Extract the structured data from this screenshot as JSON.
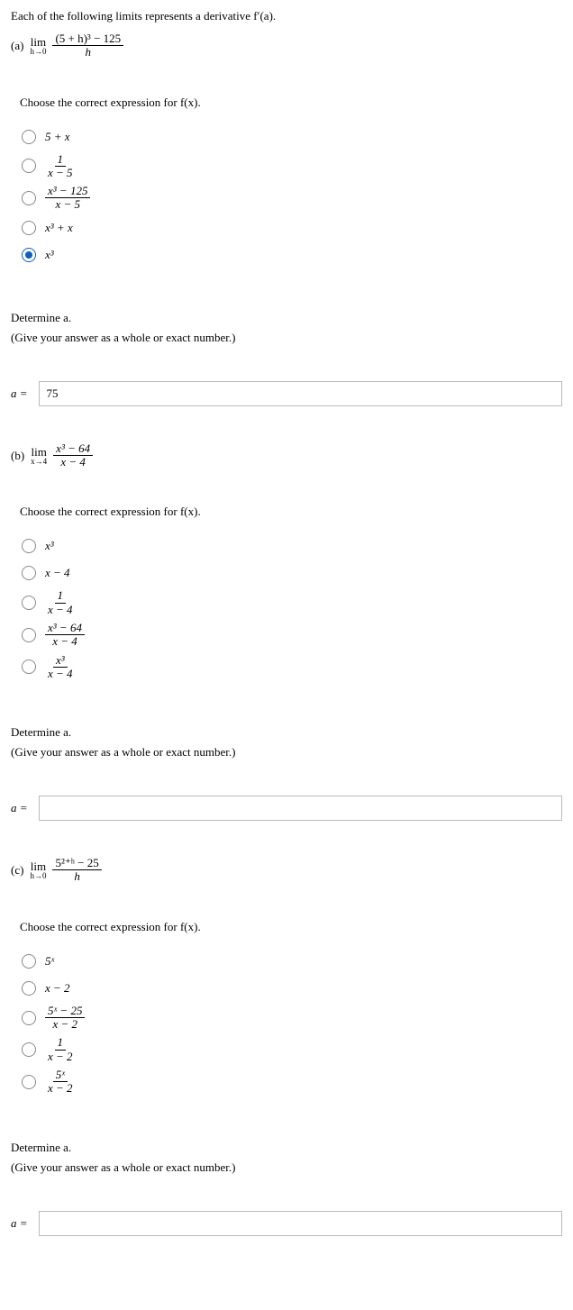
{
  "intro": "Each of the following limits represents a derivative f′(a).",
  "parts": {
    "a": {
      "label": "(a)",
      "limit_prefix": "lim",
      "limit_sub": "h→0",
      "limit_num": "(5 + h)³ − 125",
      "limit_den": "h",
      "choose_prompt": "Choose the correct expression for f(x).",
      "options": [
        {
          "text_plain": "5 + x",
          "frac": null,
          "selected": false
        },
        {
          "text_plain": null,
          "frac": {
            "num": "1",
            "den": "x − 5"
          },
          "selected": false
        },
        {
          "text_plain": null,
          "frac": {
            "num": "x³ − 125",
            "den": "x − 5"
          },
          "selected": false
        },
        {
          "text_plain": "x³ + x",
          "frac": null,
          "selected": false
        },
        {
          "text_plain": "x³",
          "frac": null,
          "selected": true
        }
      ],
      "determine_title": "Determine a.",
      "determine_note": "(Give your answer as a whole or exact number.)",
      "answer_label": "a =",
      "answer_value": "75"
    },
    "b": {
      "label": "(b)",
      "limit_prefix": "lim",
      "limit_sub": "x→4",
      "limit_num": "x³ − 64",
      "limit_den": "x − 4",
      "choose_prompt": "Choose the correct expression for f(x).",
      "options": [
        {
          "text_plain": "x³",
          "frac": null,
          "selected": false
        },
        {
          "text_plain": "x − 4",
          "frac": null,
          "selected": false
        },
        {
          "text_plain": null,
          "frac": {
            "num": "1",
            "den": "x − 4"
          },
          "selected": false
        },
        {
          "text_plain": null,
          "frac": {
            "num": "x³ − 64",
            "den": "x − 4"
          },
          "selected": false
        },
        {
          "text_plain": null,
          "frac": {
            "num": "x³",
            "den": "x − 4"
          },
          "selected": false
        }
      ],
      "determine_title": "Determine a.",
      "determine_note": "(Give your answer as a whole or exact number.)",
      "answer_label": "a =",
      "answer_value": ""
    },
    "c": {
      "label": "(c)",
      "limit_prefix": "lim",
      "limit_sub": "h→0",
      "limit_num": "5²⁺ʰ − 25",
      "limit_den": "h",
      "choose_prompt": "Choose the correct expression for f(x).",
      "options": [
        {
          "text_plain": "5ˣ",
          "frac": null,
          "selected": false
        },
        {
          "text_plain": "x − 2",
          "frac": null,
          "selected": false
        },
        {
          "text_plain": null,
          "frac": {
            "num": "5ˣ − 25",
            "den": "x − 2"
          },
          "selected": false
        },
        {
          "text_plain": null,
          "frac": {
            "num": "1",
            "den": "x − 2"
          },
          "selected": false
        },
        {
          "text_plain": null,
          "frac": {
            "num": "5ˣ",
            "den": "x − 2"
          },
          "selected": false
        }
      ],
      "determine_title": "Determine a.",
      "determine_note": "(Give your answer as a whole or exact number.)",
      "answer_label": "a =",
      "answer_value": ""
    }
  }
}
